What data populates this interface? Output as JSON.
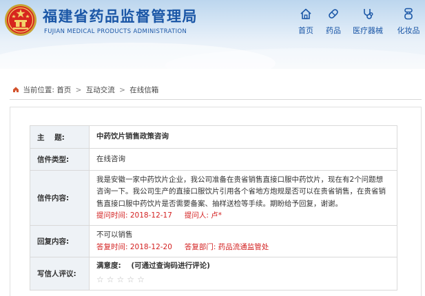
{
  "header": {
    "title": "福建省药品监督管理局",
    "subtitle": "FUJIAN MEDICAL PRODUCTS ADMINISTRATION",
    "nav": [
      {
        "label": "首页",
        "icon": "home-icon"
      },
      {
        "label": "药品",
        "icon": "capsule-icon"
      },
      {
        "label": "医疗器械",
        "icon": "stethoscope-icon"
      },
      {
        "label": "化妆品",
        "icon": "cosmetic-bottle-icon"
      }
    ]
  },
  "breadcrumb": {
    "prefix": "当前位置:",
    "items": [
      "首页",
      "互动交流",
      "在线信箱"
    ],
    "separator": ">"
  },
  "letter": {
    "rows": [
      {
        "label": "主    题:",
        "value": "中药饮片销售政策咨询"
      },
      {
        "label": "信件类型:",
        "value": "在线咨询"
      },
      {
        "label": "信件内容:",
        "value": "我是安徽一家中药饮片企业，我公司准备在贵省销售直接口服中药饮片，现在有2个问题想咨询一下。我公司生产的直接口服饮片引用各个省地方炮规是否可以在贵省销售，在贵省销售直接口服中药饮片是否需要备案、抽样送检等手续。期盼给予回复，谢谢。",
        "meta1": "提问时间:  2018-12-17",
        "meta2": "提问人: 卢*"
      },
      {
        "label": "回复内容:",
        "value": "不可以销售",
        "meta1": "答复时间:  2018-12-20",
        "meta2": "答复部门: 药品流通监管处"
      },
      {
        "label": "写信人评议:",
        "value": "满意度:    (可通过查询码进行评论)"
      }
    ],
    "stars": [
      "☆",
      "☆",
      "☆",
      "☆",
      "☆"
    ]
  },
  "colors": {
    "brand": "#1a56a6",
    "highlight_red": "#d32121",
    "label_bg": "#eef2f6"
  }
}
